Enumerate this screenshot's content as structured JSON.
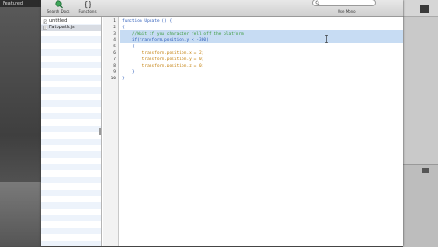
{
  "background": {
    "left_tab_label": "Featured"
  },
  "toolbar": {
    "search_docs_label": "Search Docs",
    "functions_label": "Functions",
    "search_placeholder": "",
    "use_mono_label": "Use Mono",
    "icons": {
      "search_docs": "magnifier-icon",
      "functions": "braces-icon",
      "search": "search-icon"
    }
  },
  "sidebar": {
    "files": [
      {
        "name": "untitled",
        "icon": "document-icon",
        "selected": false
      },
      {
        "name": "Fatbpath.js",
        "icon": "script-icon",
        "selected": true
      }
    ]
  },
  "editor": {
    "line_numbers": [
      "1",
      "2",
      "3",
      "4",
      "5",
      "6",
      "7",
      "8",
      "9",
      "10"
    ],
    "lines": [
      "function Update () {",
      "{",
      "    //Wait if you character fell off the platform",
      "    if(transform.position.y < -300)",
      "    {",
      "        transform.position.x = 2;",
      "        transform.position.y = 0;",
      "        transform.position.z = 0;",
      "    }",
      "}"
    ],
    "highlighted_lines": [
      3,
      4
    ]
  },
  "colors": {
    "keyword": "#2a5ab8",
    "comment": "#3a9a3a",
    "member": "#c07a00",
    "number": "#7a1a1a",
    "highlight": "#c7dcf3"
  }
}
